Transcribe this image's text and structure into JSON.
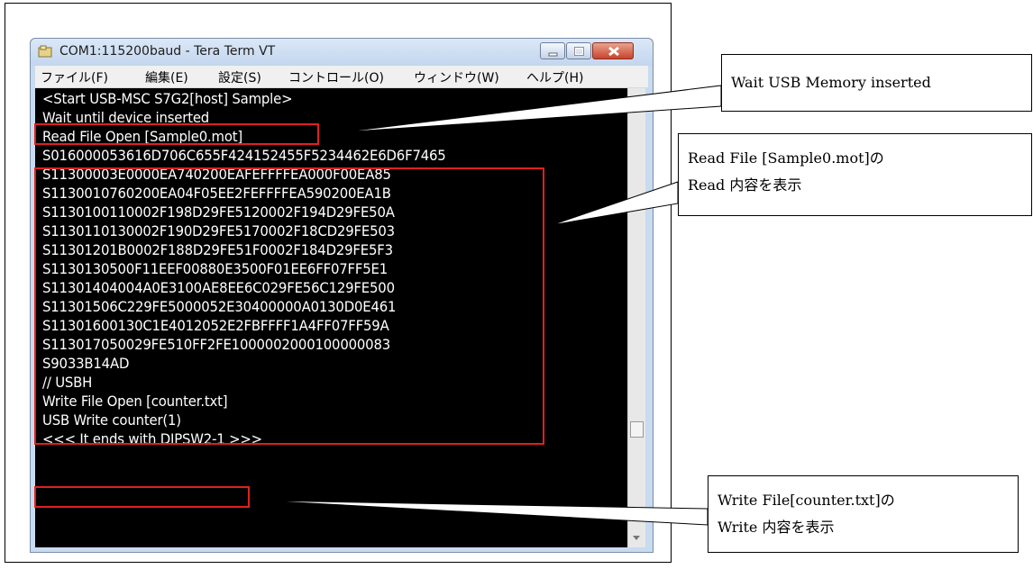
{
  "window": {
    "title": "COM1:115200baud - Tera Term VT",
    "menu": [
      "ファイル(F)",
      "編集(E)",
      "設定(S)",
      "コントロール(O)",
      "ウィンドウ(W)",
      "ヘルプ(H)"
    ]
  },
  "terminal": {
    "lines": [
      "<Start USB-MSC S7G2[host] Sample>",
      "Wait until device inserted",
      "Read File Open [Sample0.mot]",
      "S016000053616D706C655F424152455F5234462E6D6F7465",
      "S11300003E0000EA740200EAFEFFFFEA000F00EA85",
      "S1130010760200EA04F05EE2FEFFFFEA590200EA1B",
      "S1130100110002F198D29FE5120002F194D29FE50A",
      "S1130110130002F190D29FE5170002F18CD29FE503",
      "S11301201B0002F188D29FE51F0002F184D29FE5F3",
      "S1130130500F11EEF00880E3500F01EE6FF07FF5E1",
      "S11301404004A0E3100AE8EE6C029FE56C129FE500",
      "S11301506C229FE5000052E30400000A0130D0E461",
      "S11301600130C1E4012052E2FBFFFF1A4FF07FF59A",
      "S113017050029FE510FF2FE1000002000100000083",
      "S9033B14AD",
      "// USBH",
      "Write File Open [counter.txt]",
      "USB Write counter(1)",
      "<<< It ends with DIPSW2-1 >>>"
    ]
  },
  "callouts": {
    "usb_wait": "Wait USB Memory inserted",
    "read_line1": "Read File [Sample0.mot]の",
    "read_line2": "Read 内容を表示",
    "write_line1": "Write File[counter.txt]の",
    "write_line2": "Write 内容を表示"
  },
  "colors": {
    "highlight_box": "#e02020",
    "terminal_bg": "#000000",
    "terminal_text": "#ffffff"
  }
}
